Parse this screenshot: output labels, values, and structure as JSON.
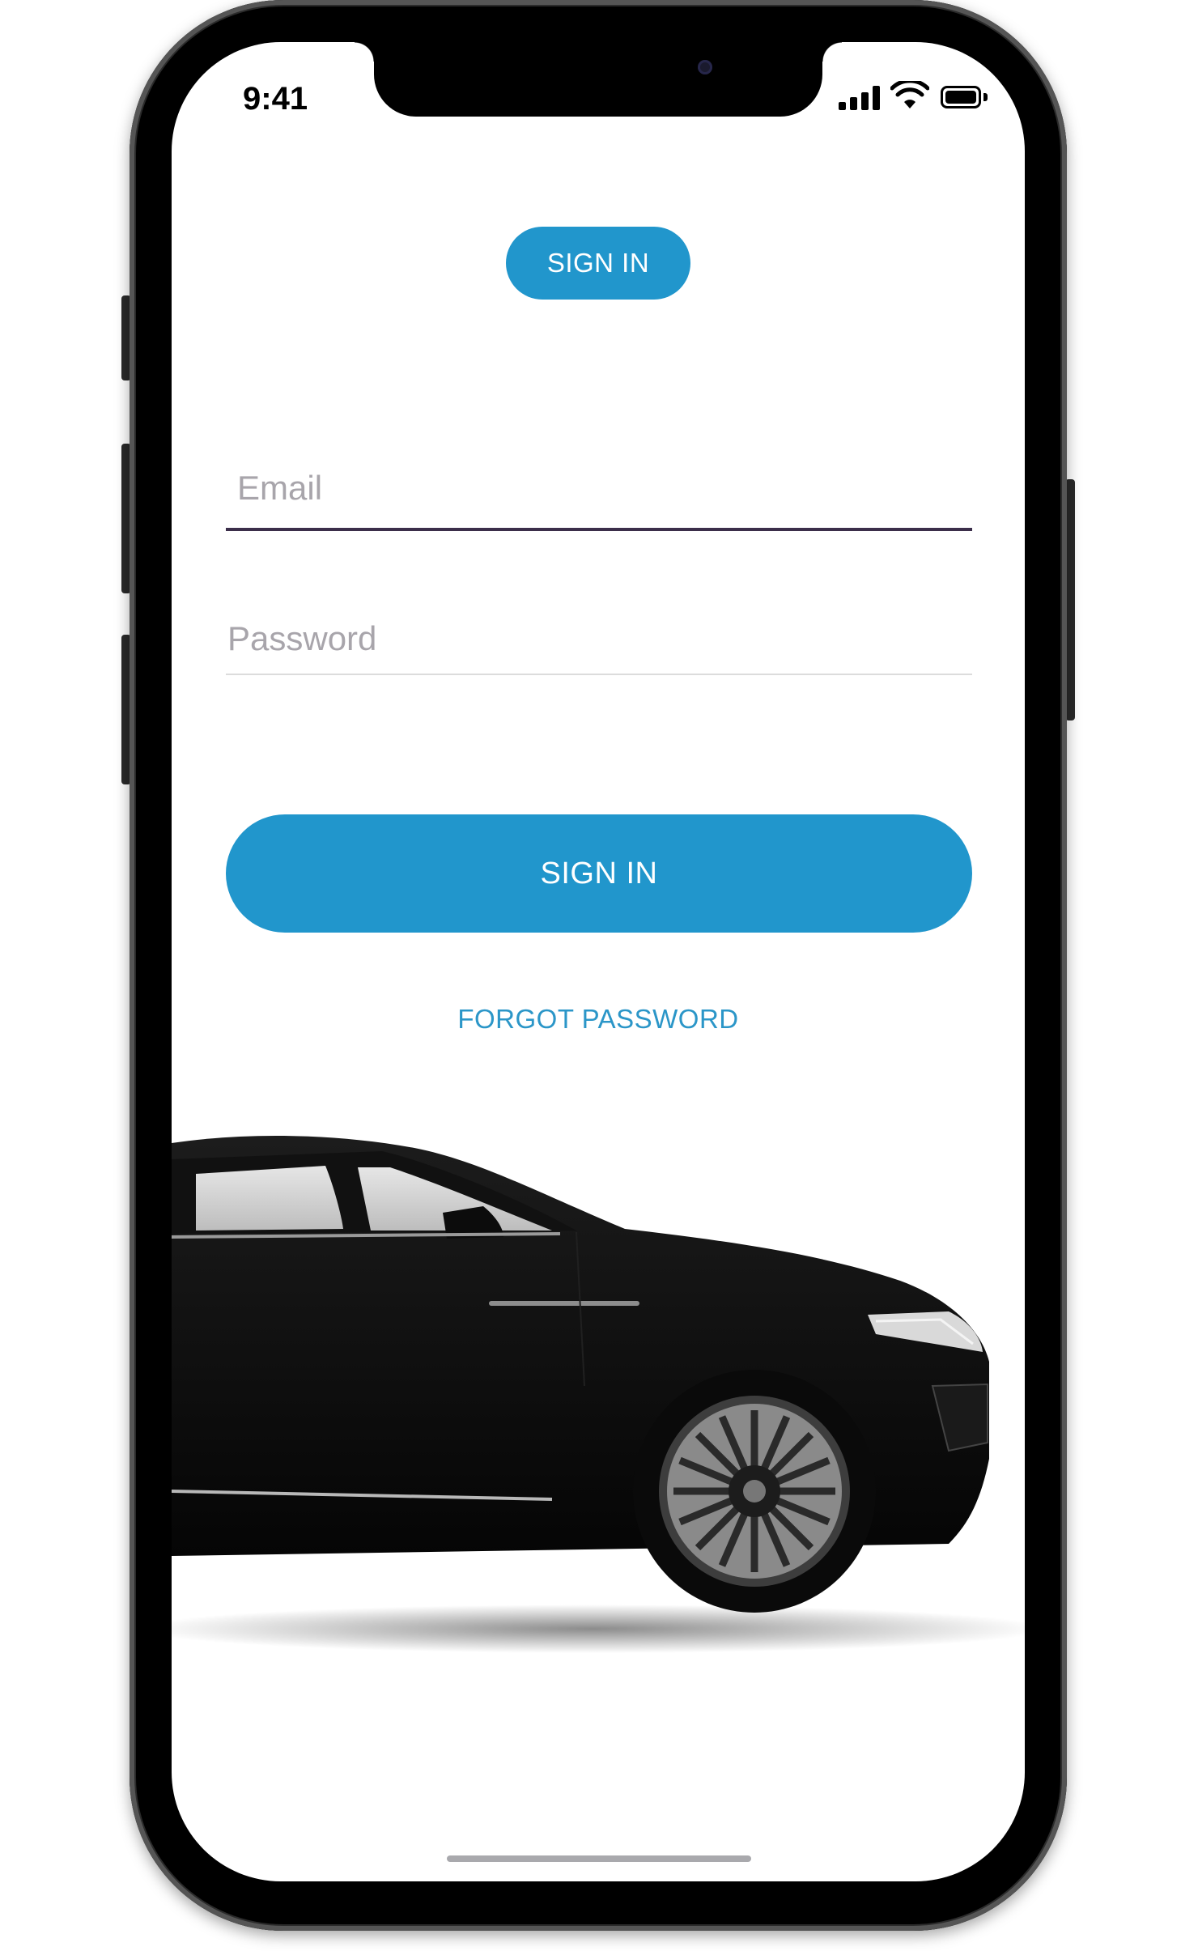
{
  "status_bar": {
    "time": "9:41"
  },
  "login": {
    "tab_label": "SIGN IN",
    "email_placeholder": "Email",
    "password_placeholder": "Password",
    "submit_label": "SIGN IN",
    "forgot_label": "FORGOT PASSWORD"
  },
  "icons": {
    "signal": "cellular-signal-icon",
    "wifi": "wifi-icon",
    "battery": "battery-icon"
  },
  "colors": {
    "accent": "#2196cc",
    "link": "#2b96c8",
    "placeholder": "#a8a5ab",
    "active_underline": "#3b2e4a"
  }
}
